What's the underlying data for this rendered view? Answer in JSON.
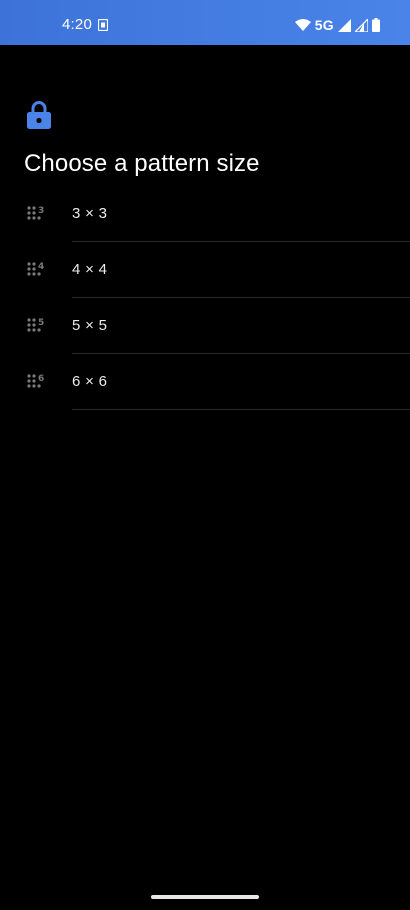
{
  "status_bar": {
    "time": "4:20",
    "network": "5G",
    "icons": [
      "sim-card-icon",
      "wifi-icon",
      "cellular-signal-icon",
      "cellular-signal-icon",
      "battery-icon"
    ]
  },
  "header": {
    "icon": "lock-icon",
    "title": "Choose a pattern size"
  },
  "options": [
    {
      "label": "3 × 3",
      "badge": "3",
      "icon": "pattern-grid-icon"
    },
    {
      "label": "4 × 4",
      "badge": "4",
      "icon": "pattern-grid-icon"
    },
    {
      "label": "5 × 5",
      "badge": "5",
      "icon": "pattern-grid-icon"
    },
    {
      "label": "6 × 6",
      "badge": "6",
      "icon": "pattern-grid-icon"
    }
  ],
  "colors": {
    "status_bar": "#4a84e8",
    "accent": "#4a84e8",
    "background": "#000000",
    "text": "#ffffff",
    "icon_muted": "#7a7a7a"
  }
}
